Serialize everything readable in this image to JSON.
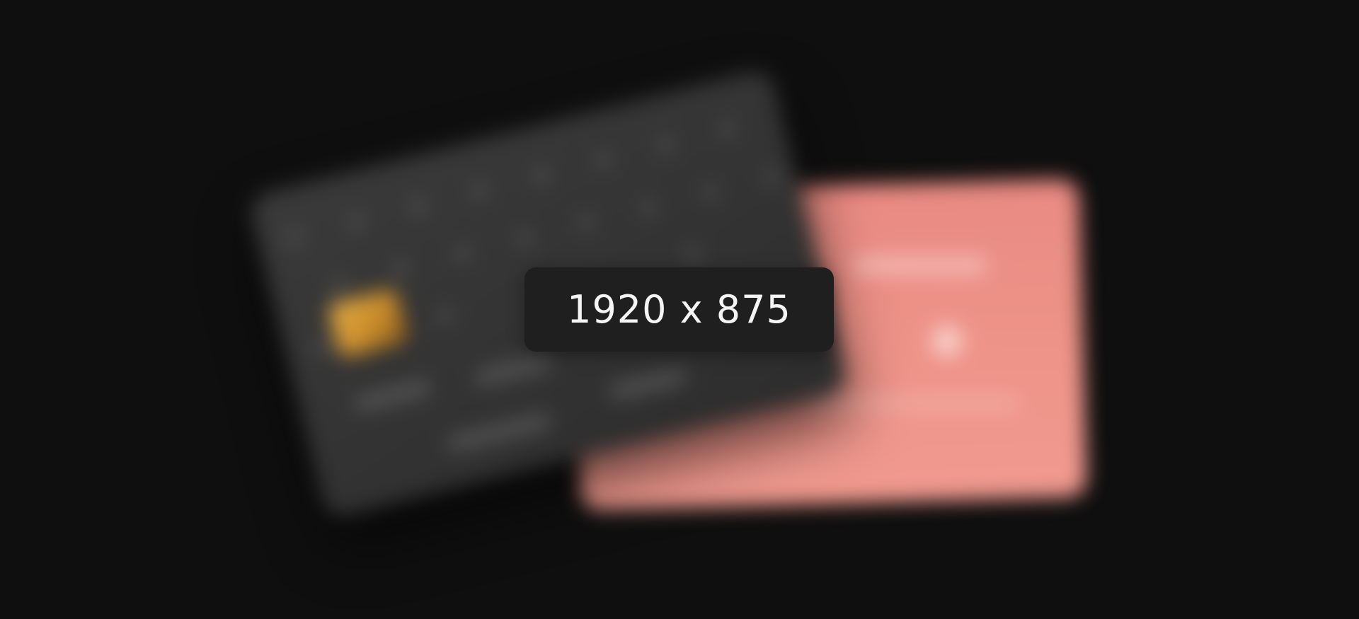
{
  "placeholder": {
    "size_label": "1920 x 875"
  },
  "colors": {
    "background": "#0f0f0f",
    "badge": "#1f1f1f",
    "dark_card": "#353535",
    "pink_card": "#ee9288",
    "chip": "#d49a36"
  },
  "icons": {
    "card_chip": "chip-icon"
  }
}
